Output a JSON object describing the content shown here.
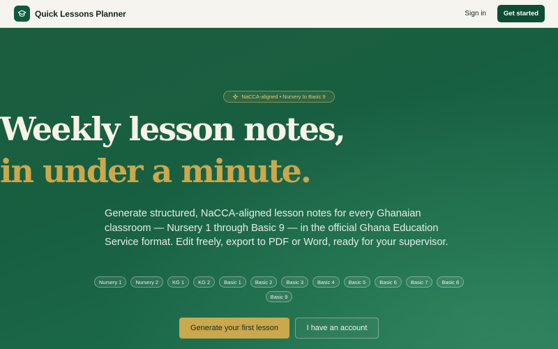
{
  "header": {
    "brand": "Quick Lessons Planner",
    "logo_icon": "graduation-cap-icon",
    "sign_in": "Sign in",
    "get_started": "Get started"
  },
  "hero": {
    "badge": "NaCCA-aligned • Nursery to Basic 9",
    "badge_icon": "sparkle-icon",
    "headline_line1": "Weekly lesson notes,",
    "headline_line2": "in under a minute.",
    "subtitle": "Generate structured, NaCCA-aligned lesson notes for every Ghanaian classroom — Nursery 1 through Basic 9 — in the official Ghana Education Service format. Edit freely, export to PDF or Word, ready for your supervisor.",
    "grades": [
      "Nursery 1",
      "Nursery 2",
      "KG 1",
      "KG 2",
      "Basic 1",
      "Basic 2",
      "Basic 3",
      "Basic 4",
      "Basic 5",
      "Basic 6",
      "Basic 7",
      "Basic 8",
      "Basic 9"
    ],
    "cta_primary": "Generate your first lesson",
    "cta_secondary": "I have an account"
  },
  "colors": {
    "brand_green": "#0e4d33",
    "hero_green": "#1a5e3e",
    "gold": "#c9a84e",
    "header_bg": "#f6f4ee"
  }
}
